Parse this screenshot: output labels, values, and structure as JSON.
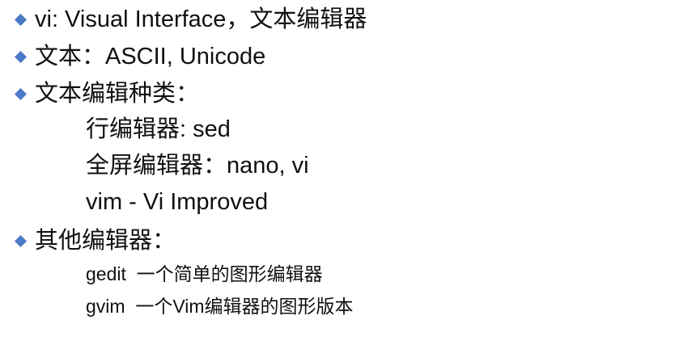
{
  "bullet_color": "#4a7ac4",
  "items": [
    {
      "text": "vi: Visual Interface，文本编辑器"
    },
    {
      "text": "文本：ASCII, Unicode"
    },
    {
      "text": "文本编辑种类："
    },
    {
      "text": "行编辑器: sed"
    },
    {
      "text": "全屏编辑器：nano, vi"
    },
    {
      "text": "vim - Vi Improved"
    },
    {
      "text": "其他编辑器："
    },
    {
      "text": "gedit  一个简单的图形编辑器"
    },
    {
      "text": "gvim  一个Vim编辑器的图形版本"
    }
  ]
}
